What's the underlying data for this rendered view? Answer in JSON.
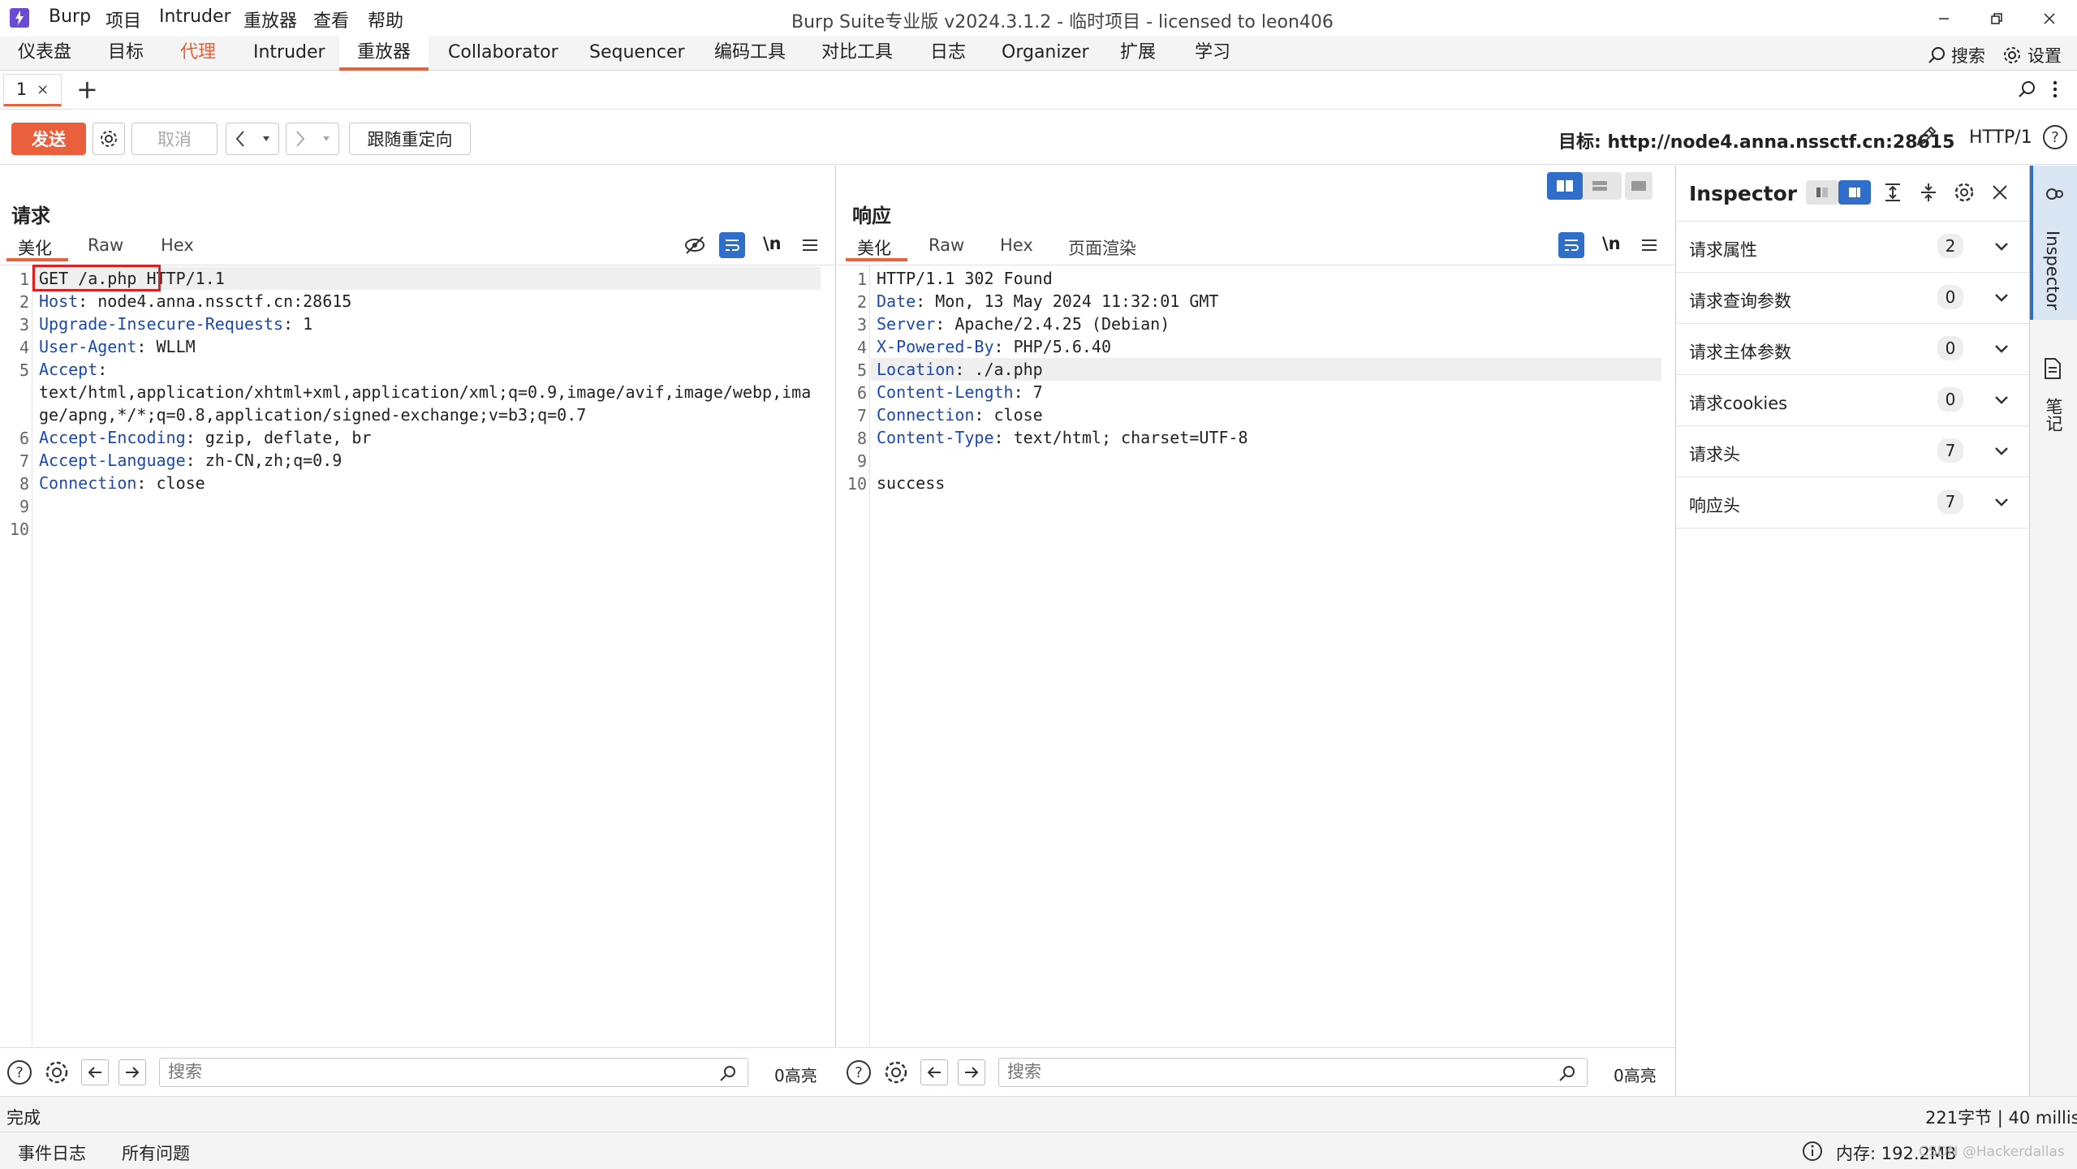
{
  "app": {
    "name": "Burp",
    "title": "Burp Suite专业版  v2024.3.1.2 - 临时项目 - licensed to leon406",
    "menu": [
      "Burp",
      "项目",
      "Intruder",
      "重放器",
      "查看",
      "帮助"
    ]
  },
  "tabs": [
    "仪表盘",
    "目标",
    "代理",
    "Intruder",
    "重放器",
    "Collaborator",
    "Sequencer",
    "编码工具",
    "对比工具",
    "日志",
    "Organizer",
    "扩展",
    "学习"
  ],
  "top_right": {
    "search": "搜索",
    "settings": "设置"
  },
  "request_tab": {
    "label": "1",
    "close": "×",
    "add": "+"
  },
  "toolbar": {
    "send": "发送",
    "cancel": "取消",
    "follow_redirect": "跟随重定向",
    "target": "目标: http://node4.anna.nssctf.cn:28615",
    "protocol": "HTTP/1"
  },
  "request": {
    "title": "请求",
    "tabs": [
      "美化",
      "Raw",
      "Hex"
    ],
    "newline_label": "\\n",
    "lines": [
      {
        "n": "1",
        "key": "",
        "sep": "",
        "val": "GET /a.php HTTP/1.1"
      },
      {
        "n": "2",
        "key": "Host",
        "sep": ": ",
        "val": "node4.anna.nssctf.cn:28615"
      },
      {
        "n": "3",
        "key": "Upgrade-Insecure-Requests",
        "sep": ": ",
        "val": "1"
      },
      {
        "n": "4",
        "key": "User-Agent",
        "sep": ": ",
        "val": "WLLM"
      },
      {
        "n": "5",
        "key": "Accept",
        "sep": ":",
        "val": ""
      },
      {
        "n": "",
        "key": "",
        "sep": "",
        "val": "text/html,application/xhtml+xml,application/xml;q=0.9,image/avif,image/webp,ima"
      },
      {
        "n": "",
        "key": "",
        "sep": "",
        "val": "ge/apng,*/*;q=0.8,application/signed-exchange;v=b3;q=0.7"
      },
      {
        "n": "6",
        "key": "Accept-Encoding",
        "sep": ": ",
        "val": "gzip, deflate, br"
      },
      {
        "n": "7",
        "key": "Accept-Language",
        "sep": ": ",
        "val": "zh-CN,zh;q=0.9"
      },
      {
        "n": "8",
        "key": "Connection",
        "sep": ": ",
        "val": "close"
      },
      {
        "n": "9",
        "key": "",
        "sep": "",
        "val": ""
      },
      {
        "n": "10",
        "key": "",
        "sep": "",
        "val": ""
      }
    ],
    "search_placeholder": "搜索",
    "highlights": "0高亮"
  },
  "response": {
    "title": "响应",
    "tabs": [
      "美化",
      "Raw",
      "Hex",
      "页面渲染"
    ],
    "newline_label": "\\n",
    "lines": [
      {
        "n": "1",
        "key": "",
        "sep": "",
        "val": "HTTP/1.1 302 Found"
      },
      {
        "n": "2",
        "key": "Date",
        "sep": ": ",
        "val": "Mon, 13 May 2024 11:32:01 GMT"
      },
      {
        "n": "3",
        "key": "Server",
        "sep": ": ",
        "val": "Apache/2.4.25 (Debian)"
      },
      {
        "n": "4",
        "key": "X-Powered-By",
        "sep": ": ",
        "val": "PHP/5.6.40"
      },
      {
        "n": "5",
        "key": "Location",
        "sep": ": ",
        "val": "./a.php"
      },
      {
        "n": "6",
        "key": "Content-Length",
        "sep": ": ",
        "val": "7"
      },
      {
        "n": "7",
        "key": "Connection",
        "sep": ": ",
        "val": "close"
      },
      {
        "n": "8",
        "key": "Content-Type",
        "sep": ": ",
        "val": "text/html; charset=UTF-8"
      },
      {
        "n": "9",
        "key": "",
        "sep": "",
        "val": ""
      },
      {
        "n": "10",
        "key": "",
        "sep": "",
        "val": "success"
      }
    ],
    "search_placeholder": "搜索",
    "highlights": "0高亮"
  },
  "inspector": {
    "title": "Inspector",
    "rows": [
      {
        "label": "请求属性",
        "count": "2"
      },
      {
        "label": "请求查询参数",
        "count": "0"
      },
      {
        "label": "请求主体参数",
        "count": "0"
      },
      {
        "label": "请求cookies",
        "count": "0"
      },
      {
        "label": "请求头",
        "count": "7"
      },
      {
        "label": "响应头",
        "count": "7"
      }
    ]
  },
  "sidebar": {
    "inspector": "Inspector",
    "notes": "笔记"
  },
  "status": {
    "left": "完成",
    "right": "221字节 | 40 millis"
  },
  "bottom": {
    "event_log": "事件日志",
    "all_issues": "所有问题",
    "memory": "内存: 192.2MB",
    "watermark": "CSDN @Hackerdallas"
  },
  "colors": {
    "accent": "#e8603c",
    "header_key": "#1a48b5",
    "active_toggle": "#2f6fc9",
    "annotation_box": "#e02020"
  }
}
